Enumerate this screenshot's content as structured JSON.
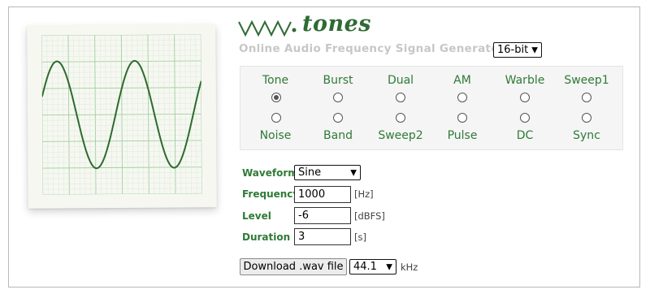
{
  "header": {
    "logo_text": "tones",
    "subtitle": "Online Audio Frequency Signal Generator",
    "bit_depth": "16-bit"
  },
  "signal_types": {
    "row1": [
      {
        "label": "Tone",
        "selected": true
      },
      {
        "label": "Burst",
        "selected": false
      },
      {
        "label": "Dual",
        "selected": false
      },
      {
        "label": "AM",
        "selected": false
      },
      {
        "label": "Warble",
        "selected": false
      },
      {
        "label": "Sweep1",
        "selected": false
      }
    ],
    "row2": [
      {
        "label": "Noise",
        "selected": false
      },
      {
        "label": "Band",
        "selected": false
      },
      {
        "label": "Sweep2",
        "selected": false
      },
      {
        "label": "Pulse",
        "selected": false
      },
      {
        "label": "DC",
        "selected": false
      },
      {
        "label": "Sync",
        "selected": false
      }
    ]
  },
  "form": {
    "waveform": {
      "label": "Waveform",
      "value": "Sine"
    },
    "frequency": {
      "label": "Frequency",
      "value": "1000",
      "unit": "[Hz]"
    },
    "level": {
      "label": "Level",
      "value": "-6",
      "unit": "[dBFS]"
    },
    "duration": {
      "label": "Duration",
      "value": "3",
      "unit": "[s]"
    }
  },
  "download": {
    "button_label": "Download .wav file",
    "sample_rate": "44.1",
    "sample_rate_unit": "kHz"
  },
  "colors": {
    "accent_green": "#2f7a37",
    "logo_green": "#2f6b33",
    "wave_green": "#2d6a2d",
    "grid_green": "#b9dcb9",
    "subtitle_gray": "#c7c7c7"
  }
}
